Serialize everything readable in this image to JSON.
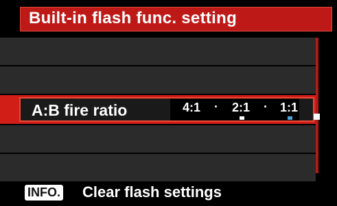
{
  "title": "Built-in flash func. setting",
  "setting": {
    "label": "A:B fire ratio",
    "ratios": [
      "4:1",
      "2:1",
      "1:1"
    ],
    "separator": "·",
    "markers": [
      {
        "under": "2:1",
        "color": "#ffffff"
      },
      {
        "under": "1:1",
        "color": "#4aa6d9"
      }
    ]
  },
  "footer": {
    "key_label": "INFO.",
    "action_label": "Clear flash settings"
  },
  "colors": {
    "accent_red": "#d11f18",
    "title_red": "#bd1a17",
    "row_gray": "#2b2b2b",
    "marker_blue": "#4aa6d9"
  }
}
